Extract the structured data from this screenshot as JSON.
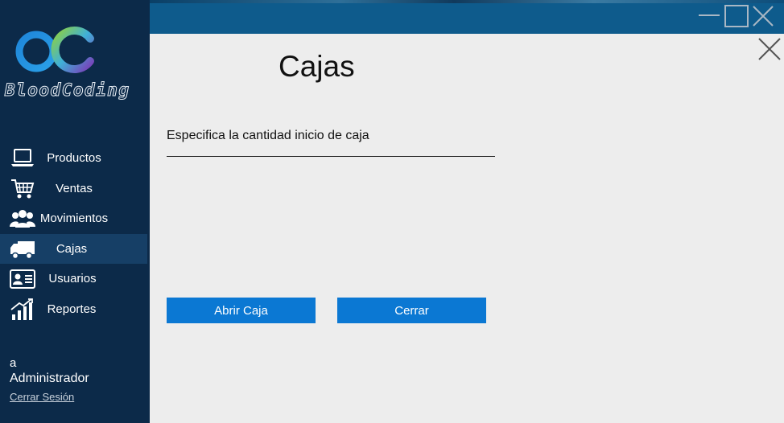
{
  "brand": {
    "logo_text": "BloodCoding",
    "colors": {
      "blue": "#1f86d9",
      "green": "#8fd13f",
      "purple": "#7a3fb8"
    }
  },
  "sidebar": {
    "items": [
      {
        "label": "Productos",
        "icon": "laptop-icon"
      },
      {
        "label": "Ventas",
        "icon": "shopping-cart-icon"
      },
      {
        "label": "Movimientos",
        "icon": "users-group-icon"
      },
      {
        "label": "Cajas",
        "icon": "truck-icon",
        "active": true
      },
      {
        "label": "Usuarios",
        "icon": "id-card-icon"
      },
      {
        "label": "Reportes",
        "icon": "bar-chart-icon"
      }
    ],
    "user": {
      "name": "a",
      "role": "Administrador",
      "logout_label": "Cerrar Sesión"
    }
  },
  "main": {
    "title": "Cajas",
    "field_label": "Especifica la cantidad inicio de caja",
    "amount_value": "",
    "buttons": {
      "open_label": "Abrir Caja",
      "close_label": "Cerrar"
    }
  },
  "colors": {
    "sidebar_bg": "#0c2a49",
    "titlebar_bg": "#0e5b8c",
    "accent": "#0b78d3",
    "content_bg": "#ededed"
  }
}
